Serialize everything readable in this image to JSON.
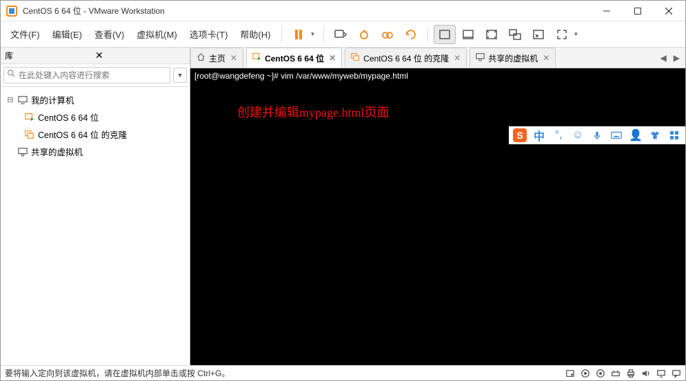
{
  "window": {
    "title": "CentOS 6 64 位 - VMware Workstation"
  },
  "menu": {
    "file": "文件(F)",
    "edit": "编辑(E)",
    "view": "查看(V)",
    "vm": "虚拟机(M)",
    "tabs": "选项卡(T)",
    "help": "帮助(H)"
  },
  "sidebar": {
    "title": "库",
    "search_placeholder": "在此处键入内容进行搜索",
    "items": {
      "root": "我的计算机",
      "child1": "CentOS 6 64 位",
      "child2": "CentOS 6 64 位 的克隆",
      "shared": "共享的虚拟机"
    }
  },
  "tabs": [
    {
      "label": "主页",
      "icon": "home"
    },
    {
      "label": "CentOS 6 64 位",
      "icon": "vm-on",
      "active": true
    },
    {
      "label": "CentOS 6 64 位 的克隆",
      "icon": "vm-clone"
    },
    {
      "label": "共享的虚拟机",
      "icon": "shared"
    }
  ],
  "terminal": {
    "prompt": "[root@wangdefeng ~]# vim /var/www/myweb/mypage.html",
    "annotation": "创建并编辑mypage.html页面"
  },
  "ime": {
    "lang": "中"
  },
  "statusbar": {
    "message": "要将输入定向到该虚拟机，请在虚拟机内部单击或按 Ctrl+G。"
  }
}
